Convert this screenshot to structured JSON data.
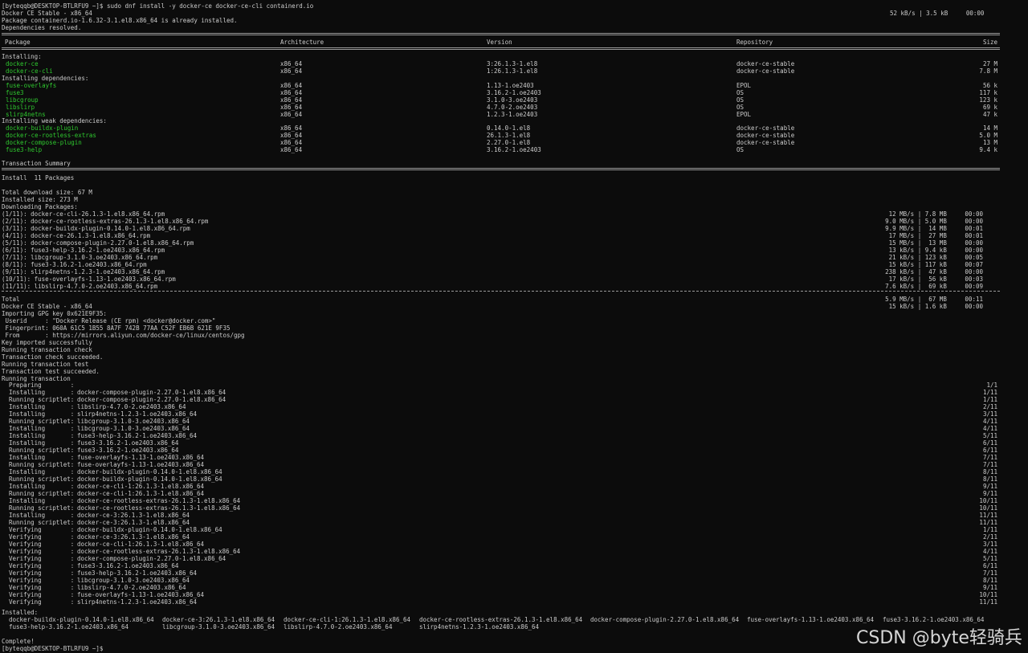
{
  "terminal": {
    "prompt_line": "[byteqqb@DESKTOP-BTLRFU9 ~]$ sudo dnf install -y docker-ce docker-ce-cli containerd.io",
    "repo_line": {
      "name": "Docker CE Stable - x86_64",
      "stats": "52 kB/s | 3.5 kB     00:00"
    },
    "already_installed": "Package containerd.io-1.6.32-3.1.el8.x86_64 is already installed.",
    "deps_resolved": "Dependencies resolved.",
    "table_headers": [
      "Package",
      "Architecture",
      "Version",
      "Repository",
      "Size"
    ],
    "installing_label": "Installing:",
    "installing": [
      [
        "docker-ce",
        "x86_64",
        "3:26.1.3-1.el8",
        "docker-ce-stable",
        "27 M"
      ],
      [
        "docker-ce-cli",
        "x86_64",
        "1:26.1.3-1.el8",
        "docker-ce-stable",
        "7.8 M"
      ]
    ],
    "installing_deps_label": "Installing dependencies:",
    "installing_deps": [
      [
        "fuse-overlayfs",
        "x86_64",
        "1.13-1.oe2403",
        "EPOL",
        "56 k"
      ],
      [
        "fuse3",
        "x86_64",
        "3.16.2-1.oe2403",
        "OS",
        "117 k"
      ],
      [
        "libcgroup",
        "x86_64",
        "3.1.0-3.oe2403",
        "OS",
        "123 k"
      ],
      [
        "libslirp",
        "x86_64",
        "4.7.0-2.oe2403",
        "OS",
        "69 k"
      ],
      [
        "slirp4netns",
        "x86_64",
        "1.2.3-1.oe2403",
        "EPOL",
        "47 k"
      ]
    ],
    "installing_weak_label": "Installing weak dependencies:",
    "installing_weak": [
      [
        "docker-buildx-plugin",
        "x86_64",
        "0.14.0-1.el8",
        "docker-ce-stable",
        "14 M"
      ],
      [
        "docker-ce-rootless-extras",
        "x86_64",
        "26.1.3-1.el8",
        "docker-ce-stable",
        "5.0 M"
      ],
      [
        "docker-compose-plugin",
        "x86_64",
        "2.27.0-1.el8",
        "docker-ce-stable",
        "13 M"
      ],
      [
        "fuse3-help",
        "x86_64",
        "3.16.2-1.oe2403",
        "OS",
        "9.4 k"
      ]
    ],
    "transaction_summary": "Transaction Summary",
    "install_count": "Install  11 Packages",
    "total_download": "Total download size: 67 M",
    "installed_size": "Installed size: 273 M",
    "downloading": "Downloading Packages:",
    "downloads": [
      [
        "(1/11): docker-ce-cli-26.1.3-1.el8.x86_64.rpm",
        "12 MB/s | 7.8 MB     00:00"
      ],
      [
        "(2/11): docker-ce-rootless-extras-26.1.3-1.el8.x86_64.rpm",
        "9.0 MB/s | 5.0 MB     00:00"
      ],
      [
        "(3/11): docker-buildx-plugin-0.14.0-1.el8.x86_64.rpm",
        "9.9 MB/s |  14 MB     00:01"
      ],
      [
        "(4/11): docker-ce-26.1.3-1.el8.x86_64.rpm",
        "17 MB/s |  27 MB     00:01"
      ],
      [
        "(5/11): docker-compose-plugin-2.27.0-1.el8.x86_64.rpm",
        "15 MB/s |  13 MB     00:00"
      ],
      [
        "(6/11): fuse3-help-3.16.2-1.oe2403.x86_64.rpm",
        "13 kB/s | 9.4 kB     00:00"
      ],
      [
        "(7/11): libcgroup-3.1.0-3.oe2403.x86_64.rpm",
        "21 kB/s | 123 kB     00:05"
      ],
      [
        "(8/11): fuse3-3.16.2-1.oe2403.x86_64.rpm",
        "15 kB/s | 117 kB     00:07"
      ],
      [
        "(9/11): slirp4netns-1.2.3-1.oe2403.x86_64.rpm",
        "238 kB/s |  47 kB     00:00"
      ],
      [
        "(10/11): fuse-overlayfs-1.13-1.oe2403.x86_64.rpm",
        "17 kB/s |  56 kB     00:03"
      ],
      [
        "(11/11): libslirp-4.7.0-2.oe2403.x86_64.rpm",
        "7.6 kB/s |  69 kB     00:09"
      ]
    ],
    "total": [
      "Total",
      "5.9 MB/s |  67 MB     00:11"
    ],
    "repo_line2": [
      "Docker CE Stable - x86_64",
      "15 kB/s | 1.6 kB     00:00"
    ],
    "gpg_lines": [
      "Importing GPG key 0x621E9F35:",
      " Userid     : \"Docker Release (CE rpm) <docker@docker.com>\"",
      " Fingerprint: 060A 61C5 1B55 8A7F 742B 77AA C52F EB6B 621E 9F35",
      " From       : https://mirrors.aliyun.com/docker-ce/linux/centos/gpg",
      "Key imported successfully",
      "Running transaction check",
      "Transaction check succeeded.",
      "Running transaction test",
      "Transaction test succeeded.",
      "Running transaction"
    ],
    "tx_steps": [
      [
        "  Preparing        :",
        "",
        "1/1"
      ],
      [
        "  Installing       :",
        "docker-compose-plugin-2.27.0-1.el8.x86_64",
        "1/11"
      ],
      [
        "  Running scriptlet:",
        "docker-compose-plugin-2.27.0-1.el8.x86_64",
        "1/11"
      ],
      [
        "  Installing       :",
        "libslirp-4.7.0-2.oe2403.x86_64",
        "2/11"
      ],
      [
        "  Installing       :",
        "slirp4netns-1.2.3-1.oe2403.x86_64",
        "3/11"
      ],
      [
        "  Running scriptlet:",
        "libcgroup-3.1.0-3.oe2403.x86_64",
        "4/11"
      ],
      [
        "  Installing       :",
        "libcgroup-3.1.0-3.oe2403.x86_64",
        "4/11"
      ],
      [
        "  Installing       :",
        "fuse3-help-3.16.2-1.oe2403.x86_64",
        "5/11"
      ],
      [
        "  Installing       :",
        "fuse3-3.16.2-1.oe2403.x86_64",
        "6/11"
      ],
      [
        "  Running scriptlet:",
        "fuse3-3.16.2-1.oe2403.x86_64",
        "6/11"
      ],
      [
        "  Installing       :",
        "fuse-overlayfs-1.13-1.oe2403.x86_64",
        "7/11"
      ],
      [
        "  Running scriptlet:",
        "fuse-overlayfs-1.13-1.oe2403.x86_64",
        "7/11"
      ],
      [
        "  Installing       :",
        "docker-buildx-plugin-0.14.0-1.el8.x86_64",
        "8/11"
      ],
      [
        "  Running scriptlet:",
        "docker-buildx-plugin-0.14.0-1.el8.x86_64",
        "8/11"
      ],
      [
        "  Installing       :",
        "docker-ce-cli-1:26.1.3-1.el8.x86_64",
        "9/11"
      ],
      [
        "  Running scriptlet:",
        "docker-ce-cli-1:26.1.3-1.el8.x86_64",
        "9/11"
      ],
      [
        "  Installing       :",
        "docker-ce-rootless-extras-26.1.3-1.el8.x86_64",
        "10/11"
      ],
      [
        "  Running scriptlet:",
        "docker-ce-rootless-extras-26.1.3-1.el8.x86_64",
        "10/11"
      ],
      [
        "  Installing       :",
        "docker-ce-3:26.1.3-1.el8.x86_64",
        "11/11"
      ],
      [
        "  Running scriptlet:",
        "docker-ce-3:26.1.3-1.el8.x86_64",
        "11/11"
      ],
      [
        "  Verifying        :",
        "docker-buildx-plugin-0.14.0-1.el8.x86_64",
        "1/11"
      ],
      [
        "  Verifying        :",
        "docker-ce-3:26.1.3-1.el8.x86_64",
        "2/11"
      ],
      [
        "  Verifying        :",
        "docker-ce-cli-1:26.1.3-1.el8.x86_64",
        "3/11"
      ],
      [
        "  Verifying        :",
        "docker-ce-rootless-extras-26.1.3-1.el8.x86_64",
        "4/11"
      ],
      [
        "  Verifying        :",
        "docker-compose-plugin-2.27.0-1.el8.x86_64",
        "5/11"
      ],
      [
        "  Verifying        :",
        "fuse3-3.16.2-1.oe2403.x86_64",
        "6/11"
      ],
      [
        "  Verifying        :",
        "fuse3-help-3.16.2-1.oe2403.x86_64",
        "7/11"
      ],
      [
        "  Verifying        :",
        "libcgroup-3.1.0-3.oe2403.x86_64",
        "8/11"
      ],
      [
        "  Verifying        :",
        "libslirp-4.7.0-2.oe2403.x86_64",
        "9/11"
      ],
      [
        "  Verifying        :",
        "fuse-overlayfs-1.13-1.oe2403.x86_64",
        "10/11"
      ],
      [
        "  Verifying        :",
        "slirp4netns-1.2.3-1.oe2403.x86_64",
        "11/11"
      ]
    ],
    "installed_label": "Installed:",
    "installed_row1": [
      "docker-buildx-plugin-0.14.0-1.el8.x86_64",
      "docker-ce-3:26.1.3-1.el8.x86_64",
      "docker-ce-cli-1:26.1.3-1.el8.x86_64",
      "docker-ce-rootless-extras-26.1.3-1.el8.x86_64",
      "docker-compose-plugin-2.27.0-1.el8.x86_64",
      "fuse-overlayfs-1.13-1.oe2403.x86_64",
      "fuse3-3.16.2-1.oe2403.x86_64"
    ],
    "installed_row2": [
      "fuse3-help-3.16.2-1.oe2403.x86_64",
      "libcgroup-3.1.0-3.oe2403.x86_64",
      "libslirp-4.7.0-2.oe2403.x86_64",
      "slirp4netns-1.2.3-1.oe2403.x86_64"
    ],
    "complete": "Complete!",
    "final_prompt": "[byteqqb@DESKTOP-BTLRFU9 ~]$"
  },
  "watermark": "CSDN @byte轻骑兵",
  "colors": {
    "background": "#0c0c0c",
    "text": "#cccccc",
    "package_green": "#2fc92f"
  }
}
